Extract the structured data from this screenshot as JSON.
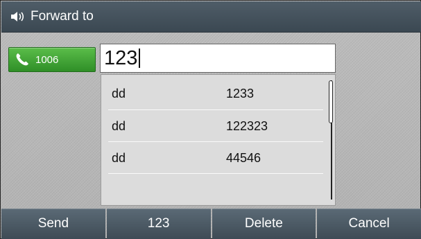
{
  "header": {
    "icon": "speaker-icon",
    "title": "Forward to"
  },
  "line_key": {
    "icon": "phone-icon",
    "label": "1006",
    "color": "#3aa52f"
  },
  "input": {
    "value": "123"
  },
  "contacts": [
    {
      "name": "dd",
      "number": "1233"
    },
    {
      "name": "dd",
      "number": "122323"
    },
    {
      "name": "dd",
      "number": "44546"
    }
  ],
  "softkeys": [
    {
      "label": "Send"
    },
    {
      "label": "123"
    },
    {
      "label": "Delete"
    },
    {
      "label": "Cancel"
    }
  ]
}
